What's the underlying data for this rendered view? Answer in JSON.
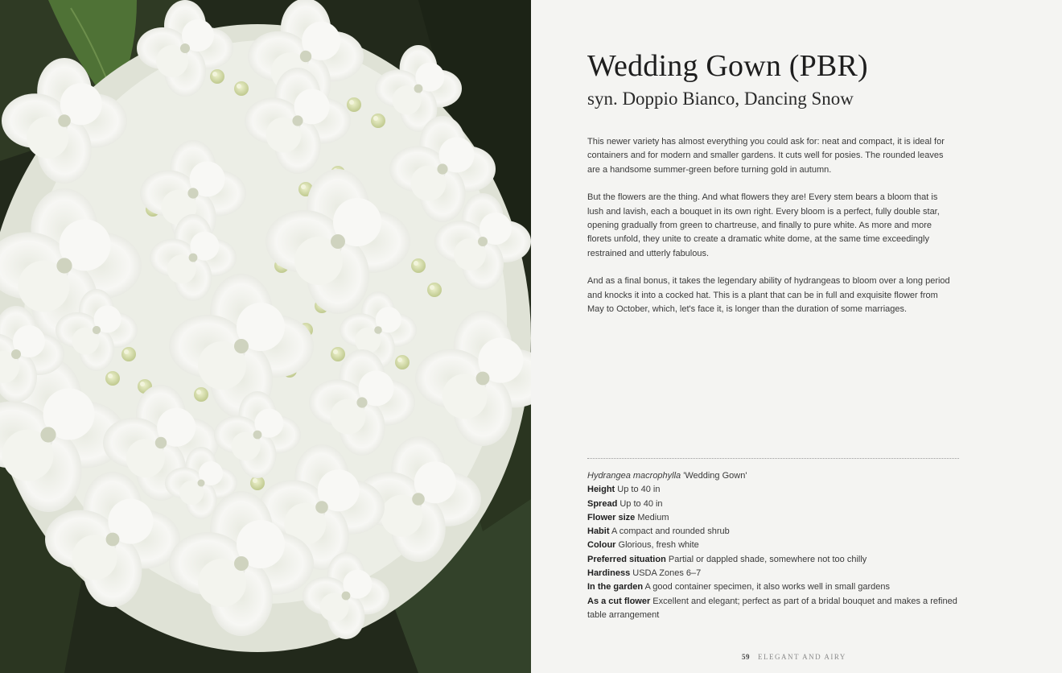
{
  "page": {
    "title": "Wedding Gown (PBR)",
    "subtitle": "syn. Doppio Bianco, Dancing Snow",
    "paragraphs": [
      "This newer variety has almost everything you could ask for: neat and compact, it is ideal for containers and for modern and smaller gardens. It cuts well for posies. The rounded leaves are a handsome summer-green before turning gold in autumn.",
      "But the flowers are the thing. And what flowers they are! Every stem bears a bloom that is lush and lavish, each a bouquet in its own right. Every bloom is a perfect, fully double star, opening gradually from green to chartreuse, and finally to pure white. As more and more florets unfold, they unite to create a dramatic white dome, at the same time exceedingly restrained and utterly fabulous.",
      "And as a final bonus, it takes the legendary ability of hydrangeas to bloom over a long period and knocks it into a cocked hat. This is a plant that can be in full and exquisite flower from May to October, which, let's face it, is longer than the duration of some marriages."
    ],
    "specs": {
      "latin": "Hydrangea macrophylla",
      "cultivar": " 'Wedding Gown'",
      "items": [
        {
          "label": "Height",
          "value": " Up to 40 in"
        },
        {
          "label": "Spread",
          "value": " Up to 40 in"
        },
        {
          "label": "Flower size",
          "value": " Medium"
        },
        {
          "label": "Habit",
          "value": " A compact and rounded shrub"
        },
        {
          "label": "Colour",
          "value": " Glorious, fresh white"
        },
        {
          "label": "Preferred situation",
          "value": " Partial or dappled shade, somewhere not too chilly"
        },
        {
          "label": "Hardiness",
          "value": " USDA Zones 6–7"
        },
        {
          "label": "In the garden",
          "value": " A good container specimen, it also works well in small gardens"
        },
        {
          "label": "As a cut flower",
          "value": " Excellent and elegant; perfect as part of a bridal bouquet and makes a refined table arrangement"
        }
      ]
    },
    "folio": {
      "page_number": "59",
      "section": "ELEGANT AND AIRY"
    }
  },
  "photo": {
    "subject": "white double hydrangea bloom",
    "colors": {
      "petal": "#f4f4f1",
      "bud": "#d8dfb2",
      "leaf": "#4a6a34",
      "background": "#22291b"
    }
  }
}
